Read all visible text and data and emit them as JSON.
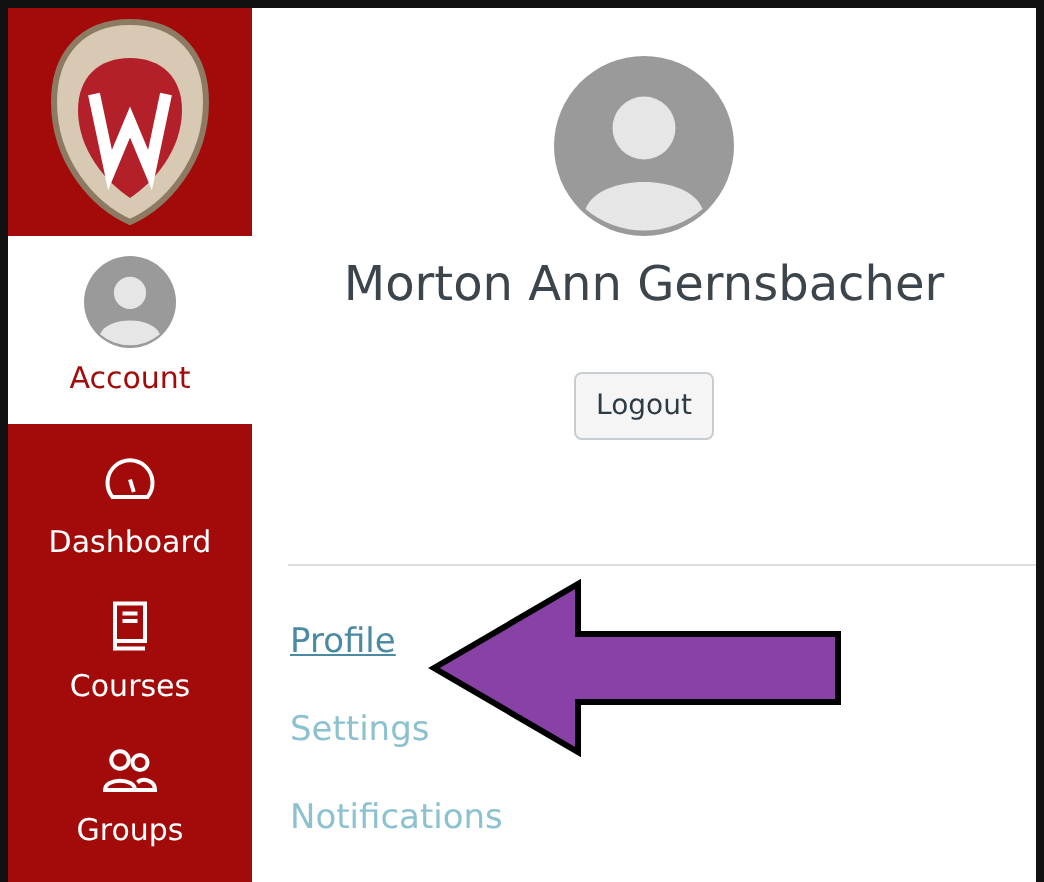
{
  "nav": [
    {
      "label": "Account",
      "kind": "avatar",
      "selected": true
    },
    {
      "label": "Dashboard",
      "kind": "gauge",
      "selected": false
    },
    {
      "label": "Courses",
      "kind": "book",
      "selected": false
    },
    {
      "label": "Groups",
      "kind": "people",
      "selected": false
    }
  ],
  "profile": {
    "name": "Morton Ann Gernsbacher",
    "button": "Logout"
  },
  "links": [
    {
      "label": "Profile",
      "selected": true
    },
    {
      "label": "Settings",
      "selected": false
    },
    {
      "label": "Notifications",
      "selected": false
    }
  ]
}
